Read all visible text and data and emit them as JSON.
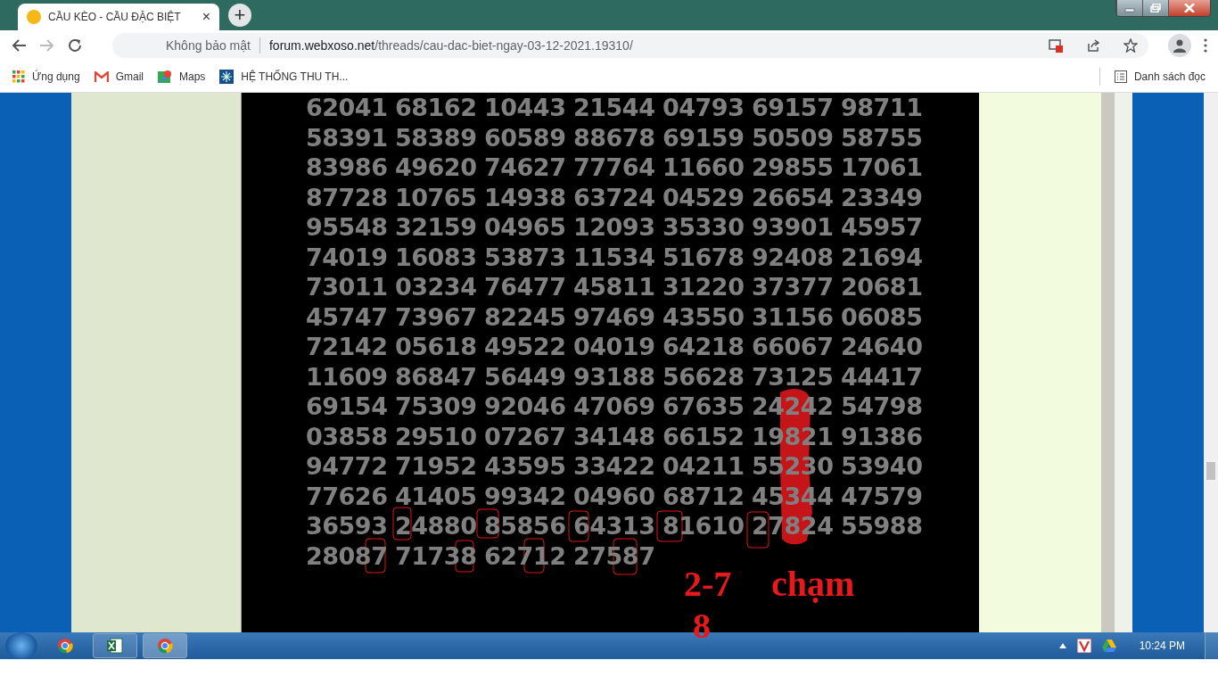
{
  "browser": {
    "tab": {
      "title": "CẦU KÈO - CẦU ĐẶC BIỆT",
      "close": "×"
    },
    "new_tab": "+",
    "address": {
      "security": "Không bảo mật",
      "url_host": "forum.webxoso.net",
      "url_path": "/threads/cau-dac-biet-ngay-03-12-2021.19310/"
    },
    "bookmarks": [
      {
        "label": "Ứng dụng",
        "kind": "apps"
      },
      {
        "label": "Gmail",
        "kind": "gmail"
      },
      {
        "label": "Maps",
        "kind": "maps"
      },
      {
        "label": "HỆ THỐNG THU TH...",
        "kind": "site"
      }
    ],
    "reading_list": "Danh sách đọc"
  },
  "image": {
    "rows": [
      [
        "62041",
        "68162",
        "10443",
        "21544",
        "04793",
        "69157",
        "98711"
      ],
      [
        "58391",
        "58389",
        "60589",
        "88678",
        "69159",
        "50509",
        "58755"
      ],
      [
        "83986",
        "49620",
        "74627",
        "77764",
        "11660",
        "29855",
        "17061"
      ],
      [
        "87728",
        "10765",
        "14938",
        "63724",
        "04529",
        "26654",
        "23349"
      ],
      [
        "95548",
        "32159",
        "04965",
        "12093",
        "35330",
        "93901",
        "45957"
      ],
      [
        "74019",
        "16083",
        "53873",
        "11534",
        "51678",
        "92408",
        "21694"
      ],
      [
        "73011",
        "03234",
        "76477",
        "45811",
        "31220",
        "37377",
        "20681"
      ],
      [
        "45747",
        "73967",
        "82245",
        "97469",
        "43550",
        "31156",
        "06085"
      ],
      [
        "72142",
        "05618",
        "49522",
        "04019",
        "64218",
        "66067",
        "24640"
      ],
      [
        "11609",
        "86847",
        "56449",
        "93188",
        "56628",
        "73125",
        "44417"
      ],
      [
        "69154",
        "75309",
        "92046",
        "47069",
        "67635",
        "24242",
        "54798"
      ],
      [
        "03858",
        "29510",
        "07267",
        "34148",
        "66152",
        "19821",
        "91386"
      ],
      [
        "94772",
        "71952",
        "43595",
        "33422",
        "04211",
        "55230",
        "53940"
      ],
      [
        "77626",
        "41405",
        "99342",
        "04960",
        "68712",
        "45344",
        "47579"
      ],
      [
        "36593",
        "24880",
        "85856",
        "64313",
        "81610",
        "27824",
        "55988"
      ],
      [
        "28087",
        "71738",
        "62712",
        "27587"
      ]
    ],
    "annotations": [
      {
        "text": "2-7"
      },
      {
        "text": "8"
      },
      {
        "text": "chạm"
      }
    ]
  },
  "taskbar": {
    "clock": "10:24 PM"
  }
}
